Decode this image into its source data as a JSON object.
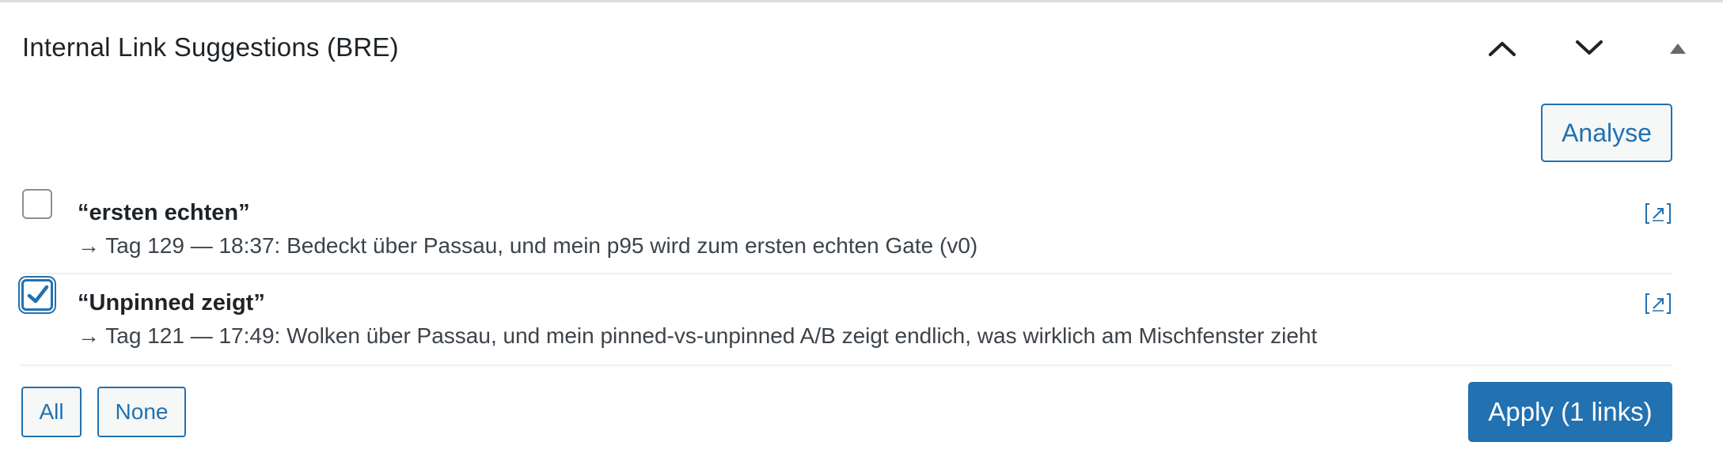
{
  "panel": {
    "title": "Internal Link Suggestions (BRE)",
    "move_up_icon": "chevron-up-icon",
    "move_down_icon": "chevron-down-icon",
    "toggle_icon": "triangle-up-icon"
  },
  "toolbar": {
    "analyse_label": "Analyse"
  },
  "suggestions": [
    {
      "checked": false,
      "anchor": "“ersten echten”",
      "target": "→ Tag 129 — 18:37: Bedeckt über Passau, und mein p95 wird zum ersten echten Gate (v0)",
      "link_icon": "external-link-icon"
    },
    {
      "checked": true,
      "anchor": "“Unpinned zeigt”",
      "target": "→ Tag 121 — 17:49: Wolken über Passau, und mein pinned-vs-unpinned A/B zeigt endlich, was wirklich am Mischfenster zieht",
      "link_icon": "external-link-icon"
    }
  ],
  "footer": {
    "all_label": "All",
    "none_label": "None",
    "apply_label": "Apply (1 links)"
  },
  "colors": {
    "accent": "#2271b1",
    "text": "#1d2327",
    "muted_text": "#3c434a",
    "border": "#dcdcde"
  }
}
